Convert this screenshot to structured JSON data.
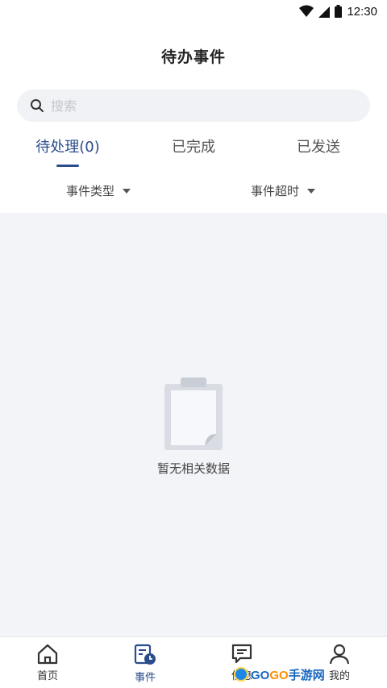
{
  "status_bar": {
    "time": "12:30"
  },
  "header": {
    "title": "待办事件"
  },
  "search": {
    "placeholder": "搜索"
  },
  "tabs": [
    {
      "label": "待处理(0)",
      "active": true
    },
    {
      "label": "已完成",
      "active": false
    },
    {
      "label": "已发送",
      "active": false
    }
  ],
  "filters": [
    {
      "label": "事件类型"
    },
    {
      "label": "事件超时"
    }
  ],
  "empty_state": {
    "text": "暂无相关数据"
  },
  "bottom_nav": [
    {
      "label": "首页",
      "icon": "home-icon",
      "active": false
    },
    {
      "label": "事件",
      "icon": "event-clock-icon",
      "active": true
    },
    {
      "label": "信息",
      "icon": "message-icon",
      "active": false
    },
    {
      "label": "我的",
      "icon": "user-icon",
      "active": false
    }
  ],
  "watermark": {
    "text_a": "GO",
    "text_b": "GO",
    "text_c": "手游网"
  },
  "colors": {
    "accent": "#2b4c8c",
    "content_bg": "#f3f4f7",
    "search_bg": "#f1f2f5"
  }
}
